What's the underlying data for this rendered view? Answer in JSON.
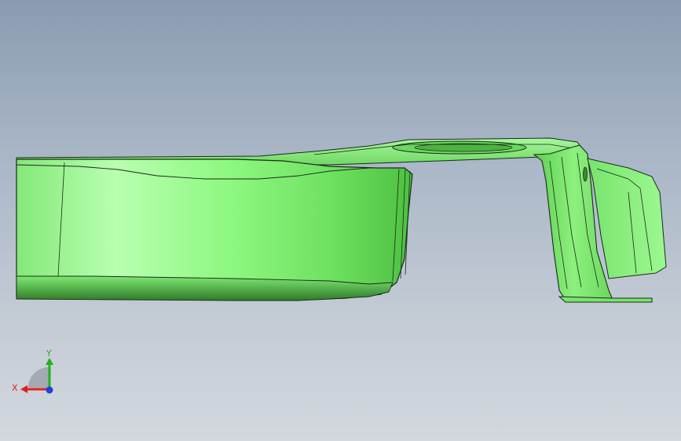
{
  "viewport": {
    "name": "cad-3d-viewport",
    "background_top": "#8a9bb1",
    "background_bottom": "#d3d8de"
  },
  "model": {
    "part_color": "#86f07a",
    "highlight_color": "#c8ffc0",
    "shadow_color": "#3a8a30",
    "edge_color": "#1a2a18"
  },
  "triad": {
    "x_label": "X",
    "y_label": "Y",
    "x_color": "#e02020",
    "y_color": "#20b020",
    "z_color": "#2040e0"
  }
}
